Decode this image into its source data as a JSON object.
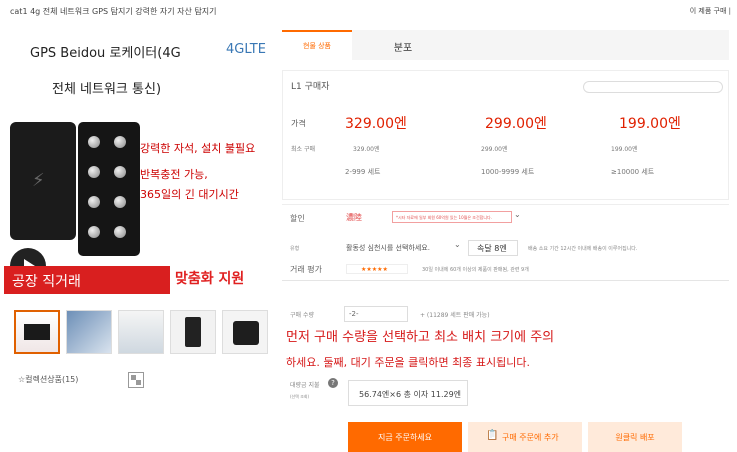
{
  "topbar": {
    "title": "cat1 4g 전체 네트워크 GPS 탐지기 강력한 자기 자산 탐지기",
    "right": "이 제품 구매 |"
  },
  "hero": {
    "line1": "GPS Beidou 로케이터(4G",
    "tag_4g": "4GLTE",
    "line2": "전체 네트워크 통신)",
    "features": [
      "강력한 자석, 설치 불필요",
      "반복충전 가능,",
      "365일의 긴 대기시간"
    ],
    "factory_banner": "공장 직거래",
    "custom_banner": "맞춤화 지원"
  },
  "gallery": {
    "count": 5
  },
  "collect": {
    "label": "☆컬렉션상품(15)"
  },
  "tabs": {
    "active": "현물 상품",
    "other": "분포"
  },
  "pricing": {
    "buyer_label": "L1 구매자",
    "price_label": "가격",
    "qty_label": "최소 구매",
    "prices": [
      "329.00엔",
      "299.00엔",
      "199.00엔"
    ],
    "subprices": [
      "329.00엔",
      "299.00엔",
      "199.00엔"
    ],
    "ranges": [
      "2-999 세트",
      "1000-9999 세트",
      "≥10000 세트"
    ]
  },
  "discount": {
    "label": "할인",
    "value": "濃陸",
    "note": "*시타 자료에 일부 회원 60억원 있는 10월은 조건합니다.",
    "spec_label": "유형",
    "spec_value": "활동성 심천시를 선택하세요.",
    "ship_label": "속달 8엔",
    "ship_note": "배송 소요 기간 12시간 이내에 배송이 이루어집니다.",
    "rating_label": "거래 평가",
    "stars": "★★★★★",
    "rating_note": "30일 이내에 60개 이상의 제품이 판매됨, 관련 9개"
  },
  "order": {
    "qty_label": "구매 수량",
    "qty_value": "-2-",
    "stock_note": "+ (11289 세트 판매 가능)",
    "red_note_1": "먼저 구매 수량을 선택하고 최소 배치 크기에 주의",
    "red_note_2": "하세요. 둘째, 대기 주문을 클릭하면 최종 표시됩니다.",
    "total_label": "대량금 지불",
    "total_sub": "(선택 조회)",
    "total_value": "56.74엔×6 총 이자 11.29엔"
  },
  "buttons": {
    "buy": "지금 주문하세요",
    "cart": "구매 주문에 추가",
    "oneclick": "원클릭 배포"
  },
  "colors": {
    "accent": "#ff6a00",
    "price_red": "#e02000",
    "banner_red": "#d91f1f"
  }
}
